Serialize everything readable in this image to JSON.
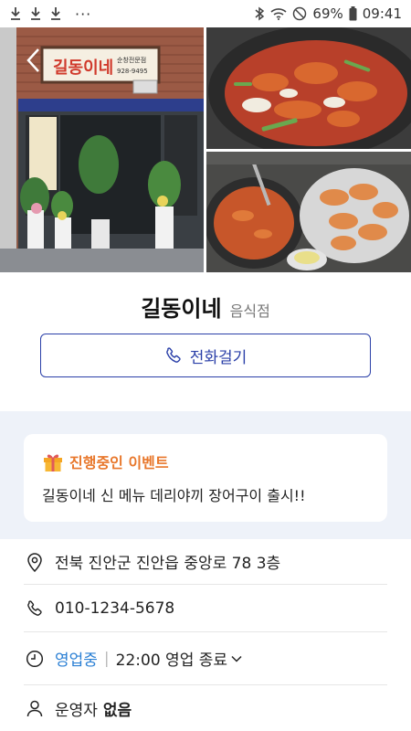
{
  "status_bar": {
    "battery": "69%",
    "time": "09:41",
    "more": "···"
  },
  "gallery": {
    "sign_text": "길동이네",
    "sign_sub": "순창전문점",
    "sign_phone": "928-9495"
  },
  "store": {
    "name": "길동이네",
    "category": "음식점"
  },
  "call_button": {
    "label": "전화걸기"
  },
  "event": {
    "title": "진행중인 이벤트",
    "text": "길동이네 신 메뉴 데리야끼 장어구이 출시!!"
  },
  "info": {
    "address": "전북 진안군 진안읍 중앙로 78 3층",
    "phone": "010-1234-5678",
    "open_status": "영업중",
    "close_time": "22:00 영업 종료",
    "owner_label": "운영자",
    "owner_value": "없음"
  },
  "colors": {
    "accent_blue": "#2a3fa8",
    "event_orange": "#e8772b",
    "open_blue": "#2a7fd4",
    "section_bg": "#eef2f9"
  }
}
